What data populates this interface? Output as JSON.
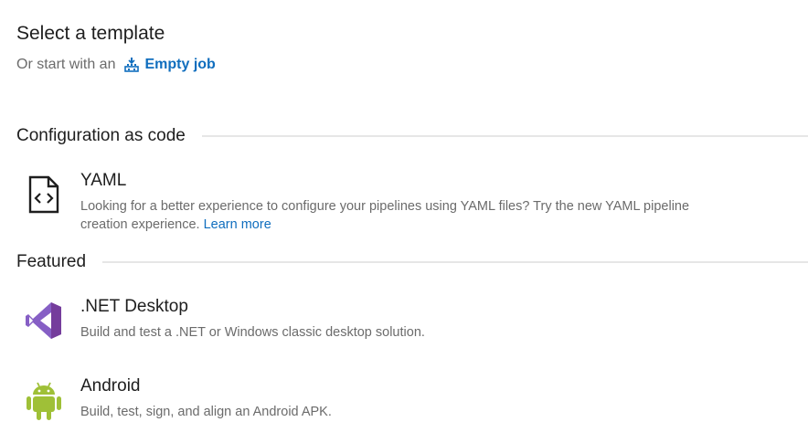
{
  "page": {
    "title": "Select a template",
    "start_prefix": "Or start with an",
    "empty_job_label": "Empty job"
  },
  "sections": [
    {
      "title": "Configuration as code",
      "items": [
        {
          "name": "YAML",
          "icon": "yaml-file-icon",
          "description": "Looking for a better experience to configure your pipelines using YAML files? Try the new YAML pipeline creation experience.",
          "link_text": "Learn more"
        }
      ]
    },
    {
      "title": "Featured",
      "items": [
        {
          "name": ".NET Desktop",
          "icon": "visual-studio-icon",
          "description": "Build and test a .NET or Windows classic desktop solution.",
          "color": "#865fc5"
        },
        {
          "name": "Android",
          "icon": "android-icon",
          "description": "Build, test, sign, and align an Android APK.",
          "color": "#9fc037"
        }
      ]
    }
  ],
  "colors": {
    "link": "#106ebe",
    "muted_text": "#6b6b6b",
    "divider": "#e6e6e6"
  }
}
